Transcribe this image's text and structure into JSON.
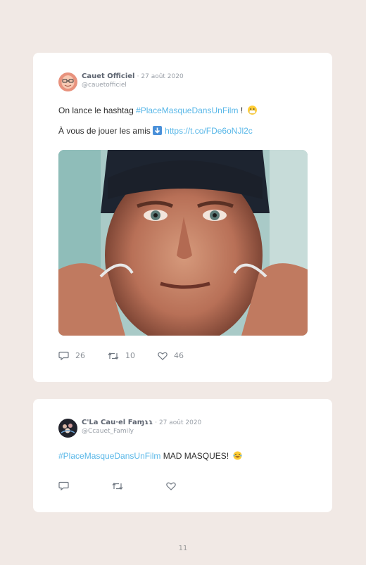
{
  "tweets": [
    {
      "name": "Cauet Officiel",
      "date": "· 27 août 2020",
      "handle": "@cauetofficiel",
      "line1": {
        "text": "On lance le hashtag ",
        "tag": "#PlaceMasqueDansUnFilm",
        "after": " !"
      },
      "line2": {
        "text": "À vous de jouer les amis ",
        "link": "https://t.co/FDe6oNJl2c"
      },
      "stats": {
        "replies": "26",
        "retweets": "10",
        "likes": "46"
      }
    },
    {
      "name": "C'La Cau·el Faɱɿɿ",
      "date": "· 27 août 2020",
      "handle": "@Ccauet_Family",
      "line1": {
        "tag": "#PlaceMasqueDansUnFilm",
        "after": " MAD MASQUES!"
      }
    }
  ],
  "page_number": "11",
  "colors": {
    "background": "#f1e9e5",
    "link": "#58b7e8",
    "card": "#ffffff"
  },
  "icons": [
    "reply-icon",
    "retweet-icon",
    "like-icon",
    "mask-emoji",
    "down-arrow-emoji",
    "laughing-emoji"
  ]
}
